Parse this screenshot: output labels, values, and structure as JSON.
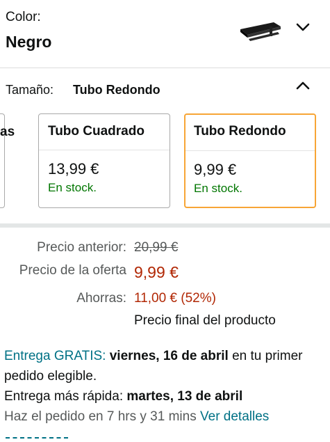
{
  "color": {
    "label": "Color:",
    "value": "Negro"
  },
  "size": {
    "label": "Tamaño:",
    "value": "Tubo Redondo",
    "options": [
      {
        "title": "as",
        "price": "",
        "stock": ""
      },
      {
        "title": "Tubo Cuadrado",
        "price": "13,99 €",
        "stock": "En stock."
      },
      {
        "title": "Tubo Redondo",
        "price": "9,99 €",
        "stock": "En stock."
      }
    ]
  },
  "pricing": {
    "previous_label": "Precio anterior:",
    "previous_value": "20,99 €",
    "offer_label": "Precio de la oferta",
    "offer_value": "9,99 €",
    "savings_label": "Ahorras:",
    "savings_value": "11,00 € (52%)",
    "final_note": "Precio final del producto"
  },
  "delivery": {
    "free_label": "Entrega GRATIS:",
    "free_date": "viernes, 16 de abril",
    "free_suffix": "en tu primer pedido elegible.",
    "fast_label": "Entrega más rápida:",
    "fast_date": "martes, 13 de abril",
    "order_within": "Haz el pedido en 7 hrs y 31 mins",
    "details_link": "Ver detalles"
  },
  "colors": {
    "accent_selected": "#f7a535",
    "stock_green": "#007600",
    "price_red": "#b12704",
    "link_teal": "#007185"
  },
  "icons": {
    "color_dropdown": "chevron-down-icon",
    "size_collapse": "chevron-up-icon"
  }
}
